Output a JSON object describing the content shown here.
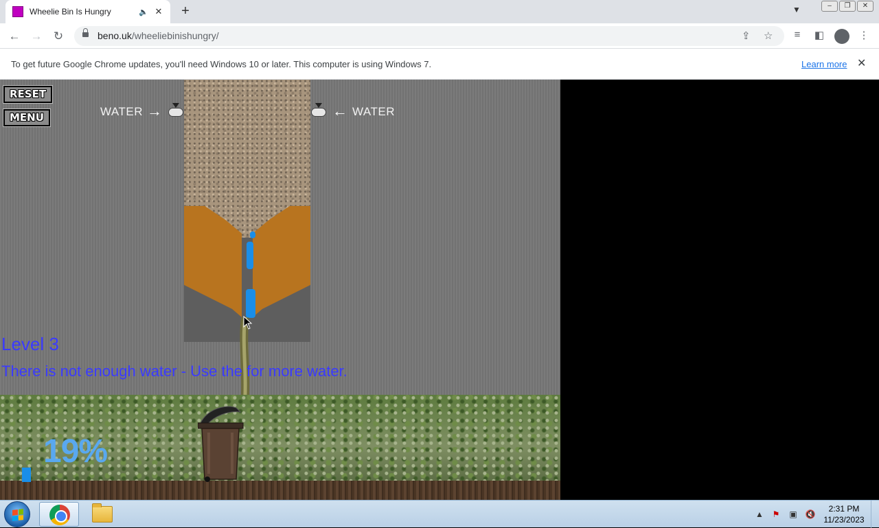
{
  "browser": {
    "tab_title": "Wheelie Bin Is Hungry",
    "tab_audio_icon": "speaker-icon",
    "tab_close": "✕",
    "new_tab": "+",
    "url_host": "beno.uk",
    "url_path": "/wheeliebinishungry/",
    "window_controls": {
      "minimize": "–",
      "restore": "❐",
      "close": "✕"
    }
  },
  "infobar": {
    "message": "To get future Google Chrome updates, you'll need Windows 10 or later. This computer is using Windows 7.",
    "link": "Learn more",
    "close": "✕"
  },
  "game": {
    "reset_label": "RESET",
    "menu_label": "MENU",
    "water_left": "WATER",
    "water_right": "WATER",
    "level_text": "Level 3",
    "message": "There is not enough water - Use the for more water.",
    "fill_percent_text": "19%",
    "fill_percent": 19,
    "colors": {
      "soil": "#b8741f",
      "water": "#1a8ee8",
      "text_blue": "#3a3aff",
      "percent": "#59a8ef"
    }
  },
  "taskbar": {
    "apps": [
      "chrome-icon",
      "file-explorer-icon"
    ],
    "tray_icons": [
      "show-hidden-icons-icon",
      "action-center-icon",
      "network-icon",
      "volume-muted-icon"
    ],
    "time": "2:31 PM",
    "date": "11/23/2023"
  }
}
